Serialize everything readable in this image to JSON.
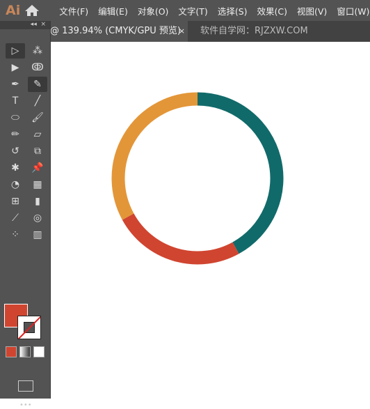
{
  "app": {
    "logo": "Ai"
  },
  "menu": [
    "文件(F)",
    "编辑(E)",
    "对象(O)",
    "文字(T)",
    "选择(S)",
    "效果(C)",
    "视图(V)",
    "窗口(W)"
  ],
  "tab": {
    "title": "@ 139.94% (CMYK/GPU 预览)",
    "close": "×"
  },
  "watermark": "软件自学网：RJZXW.COM",
  "toolbox": {
    "collapse": "◂◂",
    "close": "×",
    "more": "•••",
    "tools": [
      "selection",
      "magic-wand",
      "direct-selection",
      "lasso",
      "pen",
      "curvature",
      "type",
      "line-segment",
      "ellipse",
      "paintbrush",
      "pencil",
      "eraser",
      "rotate",
      "scale",
      "puppet-warp",
      "pin",
      "shape-builder",
      "perspective-grid",
      "mesh",
      "gradient",
      "eyedropper",
      "blend",
      "symbol-sprayer",
      "column-graph"
    ],
    "fill_color": "#d04530",
    "stroke_color": "none"
  },
  "artwork": {
    "segments": [
      {
        "color": "#116a6a",
        "fraction": 0.42
      },
      {
        "color": "#d04530",
        "fraction": 0.25
      },
      {
        "color": "#e39638",
        "fraction": 0.33
      }
    ]
  }
}
